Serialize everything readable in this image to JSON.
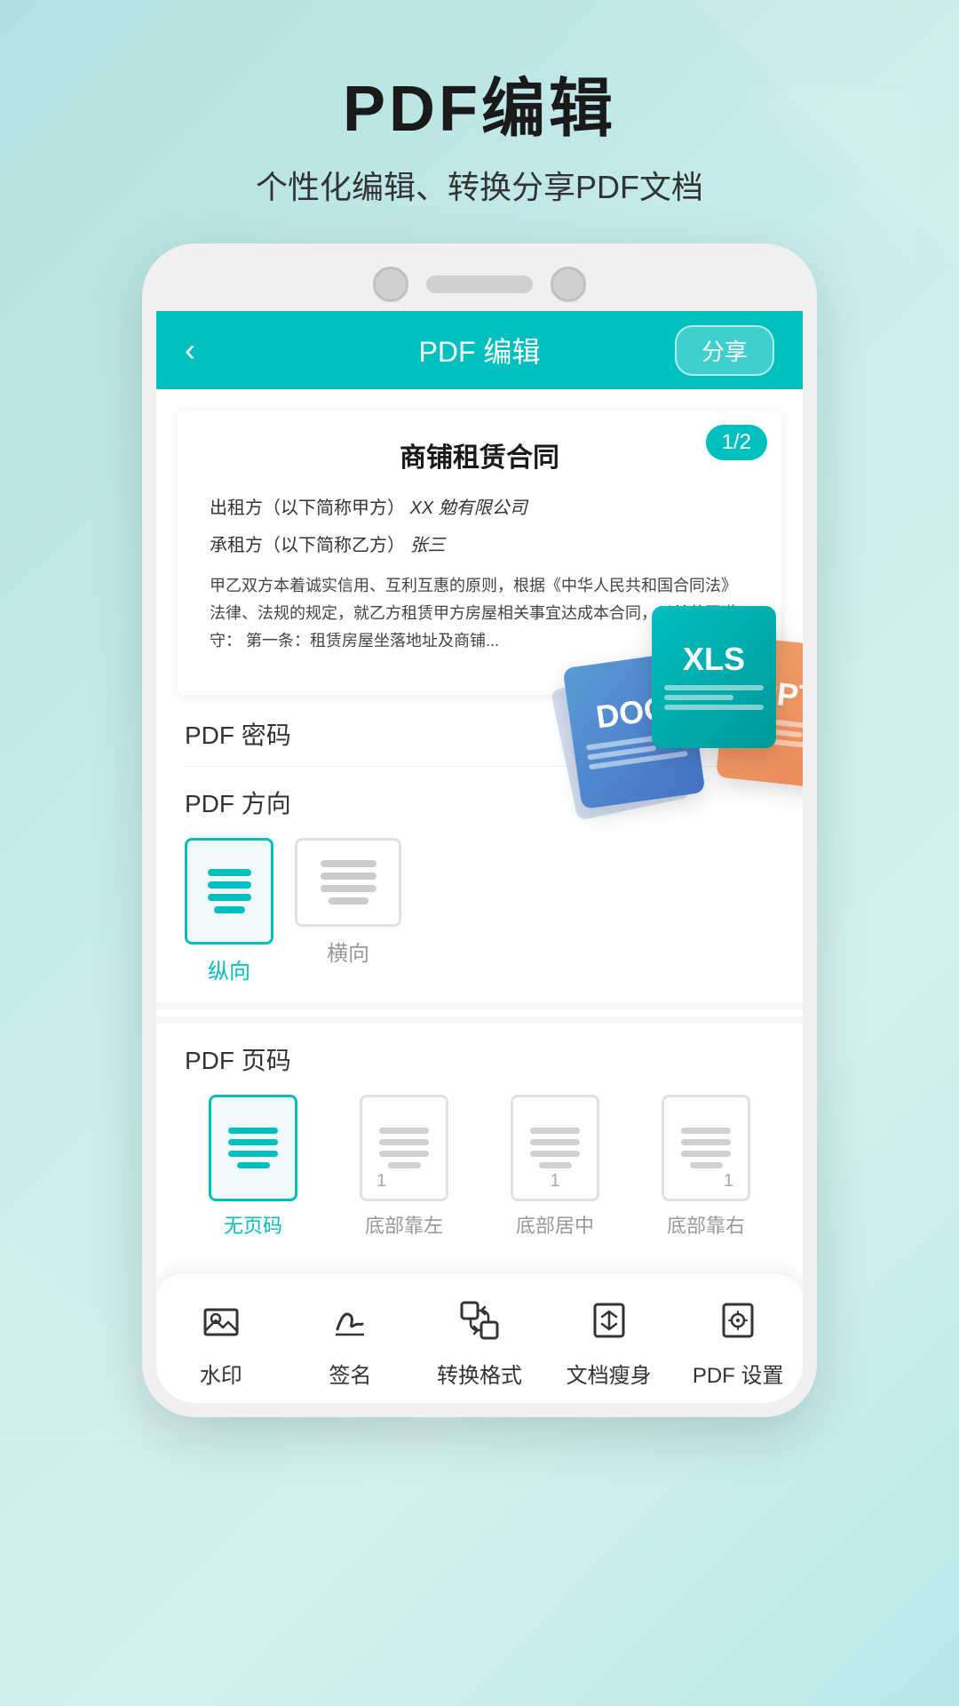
{
  "header": {
    "title": "PDF编辑",
    "subtitle": "个性化编辑、转换分享PDF文档"
  },
  "appBar": {
    "back_label": "‹",
    "title": "PDF 编辑",
    "share_label": "分享"
  },
  "document": {
    "page_badge": "1/2",
    "doc_title": "商铺租赁合同",
    "line1_prefix": "出租方（以下简称甲方）",
    "line1_value": "XX 勉有限公司",
    "line2_prefix": "承租方（以下简称乙方）",
    "line2_value": "张三",
    "body_text": "甲乙双方本着诚实信用、互利互惠的原则，根据《中华人民共和国合同法》法律、法规的规定，就乙方租赁甲方房屋相关事宜达成本合同，以兹共同遵守：\n第一条：租赁房屋坐落地址及商铺..."
  },
  "fileFormats": [
    {
      "label": "DOC",
      "color": "#4472c4"
    },
    {
      "label": "XLS",
      "color": "#00bfbf"
    },
    {
      "label": "PPT",
      "color": "#e8895a"
    }
  ],
  "sections": {
    "password": {
      "label": "PDF 密码"
    },
    "orientation": {
      "label": "PDF 方向",
      "options": [
        {
          "key": "portrait",
          "label": "纵向",
          "active": true
        },
        {
          "key": "landscape",
          "label": "横向",
          "active": false
        }
      ]
    },
    "pageCode": {
      "label": "PDF 页码",
      "options": [
        {
          "key": "none",
          "label": "无页码",
          "active": true,
          "num": null
        },
        {
          "key": "bottom-left",
          "label": "底部靠左",
          "active": false,
          "num": "1"
        },
        {
          "key": "bottom-center",
          "label": "底部居中",
          "active": false,
          "num": "1"
        },
        {
          "key": "bottom-right",
          "label": "底部靠右",
          "active": false,
          "num": "1"
        }
      ]
    }
  },
  "toolbar": {
    "items": [
      {
        "key": "watermark",
        "label": "水印",
        "icon": "watermark-icon"
      },
      {
        "key": "signature",
        "label": "签名",
        "icon": "signature-icon"
      },
      {
        "key": "convert",
        "label": "转换格式",
        "icon": "convert-icon"
      },
      {
        "key": "compress",
        "label": "文档瘦身",
        "icon": "compress-icon"
      },
      {
        "key": "settings",
        "label": "PDF 设置",
        "icon": "settings-icon"
      }
    ]
  }
}
